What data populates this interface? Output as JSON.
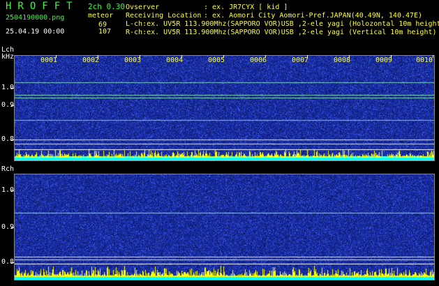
{
  "header": {
    "brand": "HROFFT",
    "file_name": "2504190000.png",
    "datetime": "25.04.19 00:00",
    "mode": "2ch 0.30",
    "meteor_label": "meteor",
    "lch_count": "69",
    "rch_count": "107",
    "observer_label": "Ovserver",
    "observer_value": ": ex. JR7CYX [ kid ]",
    "location_label": "Receiving Location",
    "location_value": ": ex. Aomori City Aomori-Pref.JAPAN(40.49N, 140.47E)",
    "lch_info": "L-ch:ex. UV5R 113.900Mhz(SAPPORO VOR)USB ,2-ele yagi (Holozontal 10m height)",
    "rch_info": "R-ch:ex. UV5R 113.900Mhz(SAPPORO VOR)USB ,2-ele yagi (Vertical 10m height)"
  },
  "markers": [
    "0001",
    "0002",
    "0003",
    "0004",
    "0005",
    "0006",
    "0007",
    "0008",
    "0009",
    "0010"
  ],
  "lch": {
    "label": "Lch",
    "unit": "kHz",
    "ticks": [
      "1.0",
      "0.9",
      "0.8"
    ]
  },
  "rch": {
    "label": "Rch",
    "ticks": [
      "1.0",
      "0.9",
      "0.8"
    ]
  },
  "colors": {
    "background": "#000000",
    "spectrogram": "#1c2e9c",
    "trace": "#ffff00",
    "baseline": "#00ffff",
    "text_green": "#33ff33"
  }
}
